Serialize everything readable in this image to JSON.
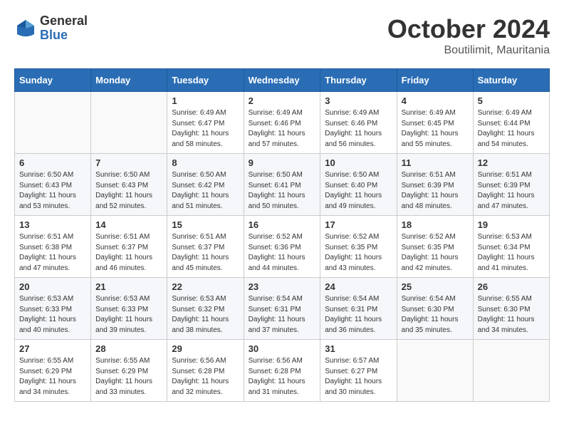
{
  "logo": {
    "general": "General",
    "blue": "Blue"
  },
  "title": {
    "month": "October 2024",
    "location": "Boutilimit, Mauritania"
  },
  "headers": [
    "Sunday",
    "Monday",
    "Tuesday",
    "Wednesday",
    "Thursday",
    "Friday",
    "Saturday"
  ],
  "weeks": [
    [
      {
        "day": "",
        "sunrise": "",
        "sunset": "",
        "daylight": ""
      },
      {
        "day": "",
        "sunrise": "",
        "sunset": "",
        "daylight": ""
      },
      {
        "day": "1",
        "sunrise": "Sunrise: 6:49 AM",
        "sunset": "Sunset: 6:47 PM",
        "daylight": "Daylight: 11 hours and 58 minutes."
      },
      {
        "day": "2",
        "sunrise": "Sunrise: 6:49 AM",
        "sunset": "Sunset: 6:46 PM",
        "daylight": "Daylight: 11 hours and 57 minutes."
      },
      {
        "day": "3",
        "sunrise": "Sunrise: 6:49 AM",
        "sunset": "Sunset: 6:46 PM",
        "daylight": "Daylight: 11 hours and 56 minutes."
      },
      {
        "day": "4",
        "sunrise": "Sunrise: 6:49 AM",
        "sunset": "Sunset: 6:45 PM",
        "daylight": "Daylight: 11 hours and 55 minutes."
      },
      {
        "day": "5",
        "sunrise": "Sunrise: 6:49 AM",
        "sunset": "Sunset: 6:44 PM",
        "daylight": "Daylight: 11 hours and 54 minutes."
      }
    ],
    [
      {
        "day": "6",
        "sunrise": "Sunrise: 6:50 AM",
        "sunset": "Sunset: 6:43 PM",
        "daylight": "Daylight: 11 hours and 53 minutes."
      },
      {
        "day": "7",
        "sunrise": "Sunrise: 6:50 AM",
        "sunset": "Sunset: 6:43 PM",
        "daylight": "Daylight: 11 hours and 52 minutes."
      },
      {
        "day": "8",
        "sunrise": "Sunrise: 6:50 AM",
        "sunset": "Sunset: 6:42 PM",
        "daylight": "Daylight: 11 hours and 51 minutes."
      },
      {
        "day": "9",
        "sunrise": "Sunrise: 6:50 AM",
        "sunset": "Sunset: 6:41 PM",
        "daylight": "Daylight: 11 hours and 50 minutes."
      },
      {
        "day": "10",
        "sunrise": "Sunrise: 6:50 AM",
        "sunset": "Sunset: 6:40 PM",
        "daylight": "Daylight: 11 hours and 49 minutes."
      },
      {
        "day": "11",
        "sunrise": "Sunrise: 6:51 AM",
        "sunset": "Sunset: 6:39 PM",
        "daylight": "Daylight: 11 hours and 48 minutes."
      },
      {
        "day": "12",
        "sunrise": "Sunrise: 6:51 AM",
        "sunset": "Sunset: 6:39 PM",
        "daylight": "Daylight: 11 hours and 47 minutes."
      }
    ],
    [
      {
        "day": "13",
        "sunrise": "Sunrise: 6:51 AM",
        "sunset": "Sunset: 6:38 PM",
        "daylight": "Daylight: 11 hours and 47 minutes."
      },
      {
        "day": "14",
        "sunrise": "Sunrise: 6:51 AM",
        "sunset": "Sunset: 6:37 PM",
        "daylight": "Daylight: 11 hours and 46 minutes."
      },
      {
        "day": "15",
        "sunrise": "Sunrise: 6:51 AM",
        "sunset": "Sunset: 6:37 PM",
        "daylight": "Daylight: 11 hours and 45 minutes."
      },
      {
        "day": "16",
        "sunrise": "Sunrise: 6:52 AM",
        "sunset": "Sunset: 6:36 PM",
        "daylight": "Daylight: 11 hours and 44 minutes."
      },
      {
        "day": "17",
        "sunrise": "Sunrise: 6:52 AM",
        "sunset": "Sunset: 6:35 PM",
        "daylight": "Daylight: 11 hours and 43 minutes."
      },
      {
        "day": "18",
        "sunrise": "Sunrise: 6:52 AM",
        "sunset": "Sunset: 6:35 PM",
        "daylight": "Daylight: 11 hours and 42 minutes."
      },
      {
        "day": "19",
        "sunrise": "Sunrise: 6:53 AM",
        "sunset": "Sunset: 6:34 PM",
        "daylight": "Daylight: 11 hours and 41 minutes."
      }
    ],
    [
      {
        "day": "20",
        "sunrise": "Sunrise: 6:53 AM",
        "sunset": "Sunset: 6:33 PM",
        "daylight": "Daylight: 11 hours and 40 minutes."
      },
      {
        "day": "21",
        "sunrise": "Sunrise: 6:53 AM",
        "sunset": "Sunset: 6:33 PM",
        "daylight": "Daylight: 11 hours and 39 minutes."
      },
      {
        "day": "22",
        "sunrise": "Sunrise: 6:53 AM",
        "sunset": "Sunset: 6:32 PM",
        "daylight": "Daylight: 11 hours and 38 minutes."
      },
      {
        "day": "23",
        "sunrise": "Sunrise: 6:54 AM",
        "sunset": "Sunset: 6:31 PM",
        "daylight": "Daylight: 11 hours and 37 minutes."
      },
      {
        "day": "24",
        "sunrise": "Sunrise: 6:54 AM",
        "sunset": "Sunset: 6:31 PM",
        "daylight": "Daylight: 11 hours and 36 minutes."
      },
      {
        "day": "25",
        "sunrise": "Sunrise: 6:54 AM",
        "sunset": "Sunset: 6:30 PM",
        "daylight": "Daylight: 11 hours and 35 minutes."
      },
      {
        "day": "26",
        "sunrise": "Sunrise: 6:55 AM",
        "sunset": "Sunset: 6:30 PM",
        "daylight": "Daylight: 11 hours and 34 minutes."
      }
    ],
    [
      {
        "day": "27",
        "sunrise": "Sunrise: 6:55 AM",
        "sunset": "Sunset: 6:29 PM",
        "daylight": "Daylight: 11 hours and 34 minutes."
      },
      {
        "day": "28",
        "sunrise": "Sunrise: 6:55 AM",
        "sunset": "Sunset: 6:29 PM",
        "daylight": "Daylight: 11 hours and 33 minutes."
      },
      {
        "day": "29",
        "sunrise": "Sunrise: 6:56 AM",
        "sunset": "Sunset: 6:28 PM",
        "daylight": "Daylight: 11 hours and 32 minutes."
      },
      {
        "day": "30",
        "sunrise": "Sunrise: 6:56 AM",
        "sunset": "Sunset: 6:28 PM",
        "daylight": "Daylight: 11 hours and 31 minutes."
      },
      {
        "day": "31",
        "sunrise": "Sunrise: 6:57 AM",
        "sunset": "Sunset: 6:27 PM",
        "daylight": "Daylight: 11 hours and 30 minutes."
      },
      {
        "day": "",
        "sunrise": "",
        "sunset": "",
        "daylight": ""
      },
      {
        "day": "",
        "sunrise": "",
        "sunset": "",
        "daylight": ""
      }
    ]
  ]
}
